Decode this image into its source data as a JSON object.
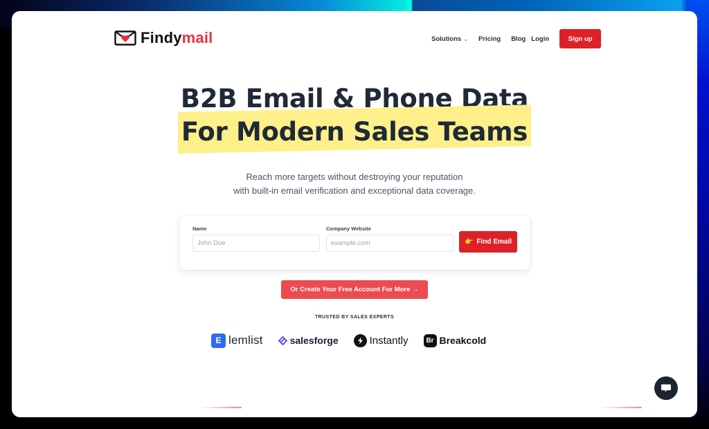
{
  "brand": {
    "name_part1": "Findy",
    "name_part2": "mail",
    "logo_icon": "envelope-heart-icon",
    "accent_color": "#e5333f"
  },
  "nav": {
    "items": [
      {
        "label": "Solutions",
        "has_dropdown": true
      },
      {
        "label": "Pricing"
      },
      {
        "label": "Blog"
      },
      {
        "label": "Login"
      }
    ],
    "signup_label": "Sign up",
    "signup_color": "#dd2128"
  },
  "hero": {
    "headline_line1": "B2B Email & Phone Data",
    "headline_line2": "For Modern Sales Teams",
    "highlight_color": "#fdf08a",
    "subtitle_line1": "Reach more targets without destroying your reputation",
    "subtitle_line2": "with built-in email verification and exceptional data coverage."
  },
  "form": {
    "name_label": "Name",
    "name_placeholder": "John Doe",
    "name_value": "",
    "website_label": "Company Website",
    "website_placeholder": "example.com",
    "website_value": "",
    "submit_label": "Find Email",
    "submit_icon": "pointing-hand-icon"
  },
  "cta": {
    "create_account_label": "Or Create Your Free Account For More →"
  },
  "trusted": {
    "heading": "TRUSTED BY SALES EXPERTS",
    "logos": [
      {
        "name": "lemlist",
        "icon_glyph": "E"
      },
      {
        "name": "salesforge"
      },
      {
        "name": "Instantly"
      },
      {
        "name": "Breakcold",
        "icon_glyph": "Br"
      }
    ]
  },
  "chat_widget": {
    "icon": "chat-bubble-icon"
  }
}
